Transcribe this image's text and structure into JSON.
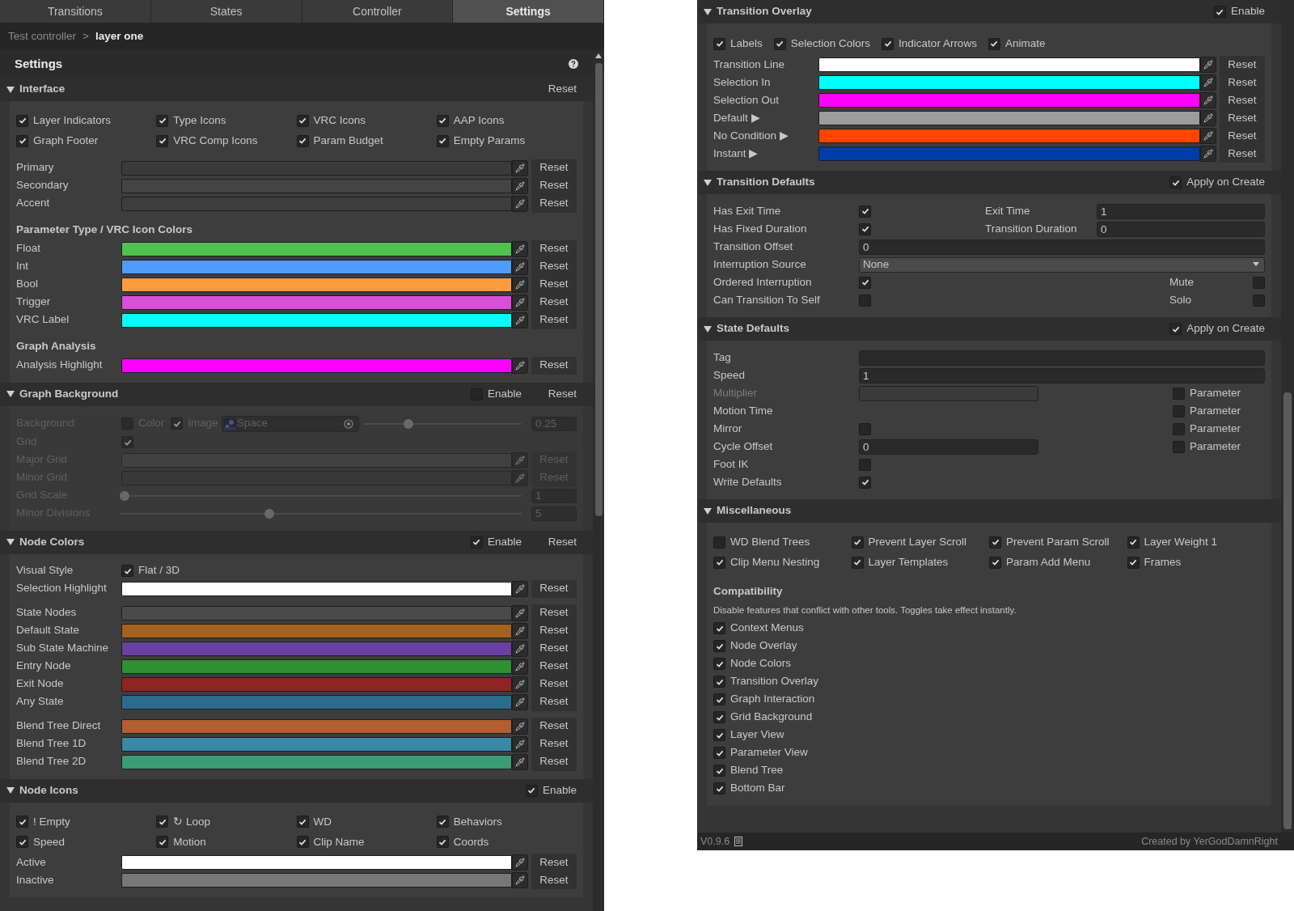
{
  "left": {
    "tabs": [
      {
        "label": "Transitions",
        "selected": false
      },
      {
        "label": "States",
        "selected": false
      },
      {
        "label": "Controller",
        "selected": false
      },
      {
        "label": "Settings",
        "selected": true
      }
    ],
    "breadcrumb": {
      "parent": "Test controller",
      "separator": ">",
      "current": "layer one"
    },
    "title": "Settings",
    "sections": [
      {
        "title": "Interface",
        "expanded": true,
        "reset": "Reset",
        "groups": [
          {
            "rows": [
              {
                "kind": "check_grid",
                "items": [
                  {
                    "label": "Layer Indicators",
                    "checked": true
                  },
                  {
                    "label": "Type Icons",
                    "checked": true
                  },
                  {
                    "label": "VRC Icons",
                    "checked": true
                  },
                  {
                    "label": "AAP Icons",
                    "checked": true
                  },
                  {
                    "label": "Graph Footer",
                    "checked": true
                  },
                  {
                    "label": "VRC Comp Icons",
                    "checked": true
                  },
                  {
                    "label": "Param Budget",
                    "checked": true
                  },
                  {
                    "label": "Empty Params",
                    "checked": true
                  }
                ]
              }
            ]
          },
          {
            "rows": [
              {
                "kind": "color",
                "label": "Primary",
                "color": "#3a3a3a",
                "reset": "Reset"
              },
              {
                "kind": "color",
                "label": "Secondary",
                "color": "#444444",
                "reset": "Reset"
              },
              {
                "kind": "color",
                "label": "Accent",
                "color": "#3d3d3d",
                "reset": "Reset"
              }
            ]
          },
          {
            "rows": [
              {
                "kind": "heading",
                "text": "Parameter Type / VRC Icon Colors"
              },
              {
                "kind": "color",
                "label": "Float",
                "color": "#4fc14f",
                "reset": "Reset"
              },
              {
                "kind": "color",
                "label": "Int",
                "color": "#4f9cff",
                "reset": "Reset"
              },
              {
                "kind": "color",
                "label": "Bool",
                "color": "#ff9b3f",
                "reset": "Reset"
              },
              {
                "kind": "color",
                "label": "Trigger",
                "color": "#d84fd8",
                "reset": "Reset"
              },
              {
                "kind": "color",
                "label": "VRC Label",
                "color": "#00ffff",
                "reset": "Reset"
              }
            ]
          },
          {
            "rows": [
              {
                "kind": "heading",
                "text": "Graph Analysis"
              },
              {
                "kind": "color",
                "label": "Analysis Highlight",
                "color": "#ff00ff",
                "reset": "Reset"
              }
            ]
          }
        ]
      },
      {
        "title": "Graph Background",
        "expanded": true,
        "enable": {
          "label": "Enable",
          "checked": false
        },
        "reset": "Reset",
        "groups": [
          {
            "rows": [
              {
                "kind": "background",
                "label": "Background",
                "color_toggle": {
                  "label": "Color",
                  "checked": false
                },
                "image_toggle": {
                  "label": "Image",
                  "checked": true
                },
                "object": "Space",
                "level": 0.27,
                "value": "0.25"
              },
              {
                "kind": "check",
                "label": "Grid",
                "checked": true
              },
              {
                "kind": "color",
                "label": "Major Grid",
                "color": "#4a4a4a",
                "reset": "Reset"
              },
              {
                "kind": "color",
                "label": "Minor Grid",
                "color": "#3a3a3a",
                "reset": "Reset"
              },
              {
                "kind": "slider",
                "label": "Grid Scale",
                "level": 0,
                "value": "1"
              },
              {
                "kind": "slider",
                "label": "Minor Divisions",
                "level": 0.37,
                "value": "5"
              }
            ]
          }
        ]
      },
      {
        "title": "Node Colors",
        "expanded": true,
        "enable": {
          "label": "Enable",
          "checked": true
        },
        "reset": "Reset",
        "groups": [
          {
            "rows": [
              {
                "kind": "check",
                "label": "Visual Style",
                "checked": true,
                "text": "Flat / 3D"
              },
              {
                "kind": "color",
                "label": "Selection Highlight",
                "color": "#ffffff",
                "reset": "Reset"
              }
            ]
          },
          {
            "rows": [
              {
                "kind": "color",
                "label": "State Nodes",
                "color": "#4a4a4a",
                "reset": "Reset"
              },
              {
                "kind": "color",
                "label": "Default State",
                "color": "#a4621f",
                "reset": "Reset"
              },
              {
                "kind": "color",
                "label": "Sub State Machine",
                "color": "#6a40a2",
                "reset": "Reset"
              },
              {
                "kind": "color",
                "label": "Entry Node",
                "color": "#2f8f33",
                "reset": "Reset"
              },
              {
                "kind": "color",
                "label": "Exit Node",
                "color": "#8e2424",
                "reset": "Reset"
              },
              {
                "kind": "color",
                "label": "Any State",
                "color": "#2a6c8e",
                "reset": "Reset"
              }
            ]
          },
          {
            "rows": [
              {
                "kind": "color",
                "label": "Blend Tree Direct",
                "color": "#b25f30",
                "reset": "Reset"
              },
              {
                "kind": "color",
                "label": "Blend Tree 1D",
                "color": "#3a87a6",
                "reset": "Reset"
              },
              {
                "kind": "color",
                "label": "Blend Tree 2D",
                "color": "#3a9c72",
                "reset": "Reset"
              }
            ]
          }
        ]
      },
      {
        "title": "Node Icons",
        "expanded": true,
        "enable": {
          "label": "Enable",
          "checked": true
        },
        "groups": [
          {
            "rows": [
              {
                "kind": "check_grid",
                "items": [
                  {
                    "label": "! Empty",
                    "checked": true
                  },
                  {
                    "label": "↻ Loop",
                    "checked": true
                  },
                  {
                    "label": "WD",
                    "checked": true
                  },
                  {
                    "label": "Behaviors",
                    "checked": true
                  },
                  {
                    "label": "Speed",
                    "checked": true
                  },
                  {
                    "label": "Motion",
                    "checked": true
                  },
                  {
                    "label": "Clip Name",
                    "checked": true
                  },
                  {
                    "label": "Coords",
                    "checked": true
                  }
                ]
              },
              {
                "kind": "color",
                "label": "Active",
                "color": "#ffffff",
                "reset": "Reset"
              },
              {
                "kind": "color",
                "label": "Inactive",
                "color": "#777777",
                "reset": "Reset"
              }
            ]
          }
        ]
      }
    ]
  },
  "right": {
    "sections": [
      {
        "title": "Transition Overlay",
        "expanded": true,
        "enable": {
          "label": "Enable",
          "checked": true
        },
        "groups": [
          {
            "rows": [
              {
                "kind": "check_row",
                "items": [
                  {
                    "label": "Labels",
                    "checked": true
                  },
                  {
                    "label": "Selection Colors",
                    "checked": true
                  },
                  {
                    "label": "Indicator Arrows",
                    "checked": true
                  },
                  {
                    "label": "Animate",
                    "checked": true
                  }
                ]
              },
              {
                "kind": "color",
                "label": "Transition Line",
                "color": "#ffffff",
                "reset": "Reset"
              },
              {
                "kind": "color",
                "label": "Selection In",
                "color": "#00ffff",
                "reset": "Reset"
              },
              {
                "kind": "color",
                "label": "Selection Out",
                "color": "#ff00ff",
                "reset": "Reset"
              },
              {
                "kind": "color",
                "label": "Default ▶",
                "color": "#9c9c9c",
                "reset": "Reset"
              },
              {
                "kind": "color",
                "label": "No Condition ▶",
                "color": "#ff4500",
                "reset": "Reset"
              },
              {
                "kind": "color",
                "label": "Instant ▶",
                "color": "#003da8",
                "reset": "Reset"
              }
            ]
          }
        ]
      },
      {
        "title": "Transition Defaults",
        "expanded": true,
        "apply": {
          "label": "Apply on Create",
          "checked": true
        },
        "groups": [
          {
            "rows": [
              {
                "kind": "form",
                "label": "Has Exit Time",
                "control": {
                  "kind": "check",
                  "checked": true
                },
                "side": {
                  "label": "Exit Time",
                  "control": {
                    "kind": "text",
                    "value": "1"
                  }
                }
              },
              {
                "kind": "form",
                "label": "Has Fixed Duration",
                "control": {
                  "kind": "check",
                  "checked": true
                },
                "side": {
                  "label": "Transition Duration",
                  "control": {
                    "kind": "text",
                    "value": "0"
                  }
                }
              },
              {
                "kind": "form",
                "label": "Transition Offset",
                "control": {
                  "kind": "text",
                  "value": "0"
                }
              },
              {
                "kind": "form",
                "label": "Interruption Source",
                "control": {
                  "kind": "dropdown",
                  "value": "None"
                }
              },
              {
                "kind": "form",
                "label": "Ordered Interruption",
                "control": {
                  "kind": "check",
                  "checked": true
                },
                "side": {
                  "label": "Mute",
                  "control": {
                    "kind": "check",
                    "checked": false
                  }
                }
              },
              {
                "kind": "form",
                "label": "Can Transition To Self",
                "control": {
                  "kind": "check",
                  "checked": false
                },
                "side": {
                  "label": "Solo",
                  "control": {
                    "kind": "check",
                    "checked": false
                  }
                }
              }
            ]
          }
        ]
      },
      {
        "title": "State Defaults",
        "expanded": true,
        "apply": {
          "label": "Apply on Create",
          "checked": true
        },
        "groups": [
          {
            "rows": [
              {
                "kind": "form",
                "label": "Tag",
                "control": {
                  "kind": "text"
                }
              },
              {
                "kind": "form",
                "label": "Speed",
                "control": {
                  "kind": "text",
                  "value": "1"
                }
              },
              {
                "kind": "form",
                "label": "Multiplier",
                "disabled": true,
                "control": {
                  "kind": "text"
                },
                "side": {
                  "label": "Parameter",
                  "control": {
                    "kind": "check_label",
                    "checked": false
                  }
                }
              },
              {
                "kind": "form",
                "label": "Motion Time",
                "side": {
                  "label": "Parameter",
                  "control": {
                    "kind": "check_label",
                    "checked": false
                  }
                }
              },
              {
                "kind": "form",
                "label": "Mirror",
                "control": {
                  "kind": "check",
                  "checked": false
                },
                "side": {
                  "label": "Parameter",
                  "control": {
                    "kind": "check_label",
                    "checked": false
                  }
                }
              },
              {
                "kind": "form",
                "label": "Cycle Offset",
                "control": {
                  "kind": "text",
                  "value": "0"
                },
                "side": {
                  "label": "Parameter",
                  "control": {
                    "kind": "check_label",
                    "checked": false
                  }
                }
              },
              {
                "kind": "form",
                "label": "Foot IK",
                "control": {
                  "kind": "check",
                  "checked": false
                }
              },
              {
                "kind": "form",
                "label": "Write Defaults",
                "control": {
                  "kind": "check",
                  "checked": true
                }
              }
            ]
          }
        ]
      },
      {
        "title": "Miscellaneous",
        "expanded": true,
        "groups": [
          {
            "rows": [
              {
                "kind": "check_grid",
                "items": [
                  {
                    "label": "WD Blend Trees",
                    "checked": false
                  },
                  {
                    "label": "Prevent Layer Scroll",
                    "checked": true
                  },
                  {
                    "label": "Prevent Param Scroll",
                    "checked": true
                  },
                  {
                    "label": "Layer Weight 1",
                    "checked": true
                  },
                  {
                    "label": "Clip Menu Nesting",
                    "checked": true
                  },
                  {
                    "label": "Layer Templates",
                    "checked": true
                  },
                  {
                    "label": "Param Add Menu",
                    "checked": true
                  },
                  {
                    "label": "Frames",
                    "checked": true
                  }
                ]
              }
            ]
          },
          {
            "rows": [
              {
                "kind": "heading",
                "text": "Compatibility"
              },
              {
                "kind": "note",
                "text": "Disable features that conflict with other tools. Toggles take effect instantly."
              },
              {
                "kind": "check_list",
                "items": [
                  {
                    "label": "Context Menus",
                    "checked": true
                  },
                  {
                    "label": "Node Overlay",
                    "checked": true
                  },
                  {
                    "label": "Node Colors",
                    "checked": true
                  },
                  {
                    "label": "Transition Overlay",
                    "checked": true
                  },
                  {
                    "label": "Graph Interaction",
                    "checked": true
                  },
                  {
                    "label": "Grid Background",
                    "checked": true
                  },
                  {
                    "label": "Layer View",
                    "checked": true
                  },
                  {
                    "label": "Parameter View",
                    "checked": true
                  },
                  {
                    "label": "Blend Tree",
                    "checked": true
                  },
                  {
                    "label": "Bottom Bar",
                    "checked": true
                  }
                ]
              }
            ]
          }
        ]
      }
    ],
    "footer": {
      "version": "V0.9.6",
      "credit": "Created by YerGodDamnRight"
    }
  }
}
